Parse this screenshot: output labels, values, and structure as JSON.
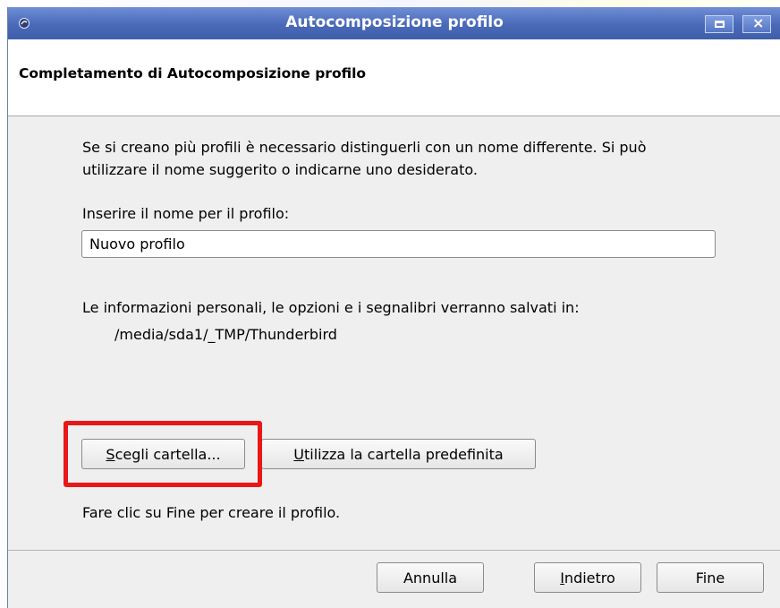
{
  "window": {
    "title": "Autocomposizione profilo"
  },
  "header": {
    "title": "Completamento di Autocomposizione profilo"
  },
  "content": {
    "description": "Se si creano più profili è necessario distinguerli con un nome differente. Si può utilizzare il nome suggerito o indicarne uno desiderato.",
    "name_label": "Inserire il nome per il profilo:",
    "name_value": "Nuovo profilo",
    "info_text": "Le informazioni personali, le opzioni e i segnalibri verranno salvati in:",
    "path": "/media/sda1/_TMP/Thunderbird",
    "choose_folder": {
      "mnemonic": "S",
      "rest": "cegli cartella..."
    },
    "default_folder": {
      "mnemonic": "U",
      "rest": "tilizza la cartella predefinita"
    },
    "finish_hint": "Fare clic su Fine per creare il profilo."
  },
  "footer": {
    "cancel": "Annulla",
    "back": {
      "mnemonic": "I",
      "rest": "ndietro"
    },
    "finish": "Fine"
  },
  "colors": {
    "titlebar": "#4a69b8",
    "highlight": "#e81818"
  },
  "icons": {
    "app": "thunderbird-icon",
    "minimize": "minimize-icon",
    "close": "close-icon"
  }
}
